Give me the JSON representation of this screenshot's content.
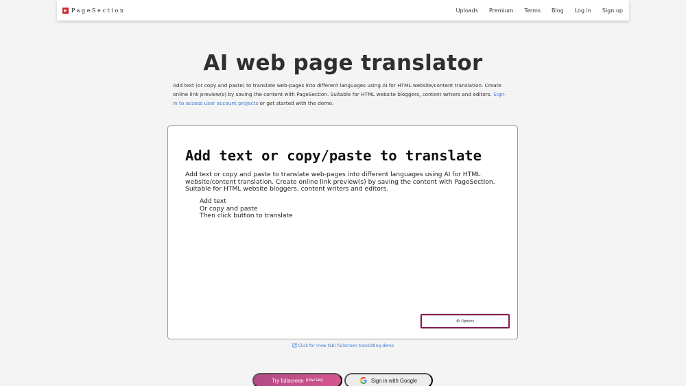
{
  "navbar": {
    "brand": "PageSection",
    "links": [
      "Uploads",
      "Premium",
      "Terms",
      "Blog",
      "Log in",
      "Sign up"
    ]
  },
  "hero": {
    "title": "AI web page translator",
    "intro_text": "Add text (or copy and paste) to translate web-pages into different languages using AI for HTML website/content translation. Create online link preview(s) by saving the content with PageSection. Suitable for HTML website bloggers, content writers and editors.",
    "signin_link": "Sign-in to access user account projects",
    "intro_tail": "or get started with the demo."
  },
  "demo": {
    "heading": "Add text or copy/paste to translate",
    "paragraph": "Add text or copy and paste to translate web-pages into different languages using AI for HTML website/content translation. Create online link preview(s) by saving the content with PageSection. Suitable for HTML website bloggers, content writers and editors.",
    "steps": [
      "Add text",
      "Or copy and paste",
      "Then click button to translate"
    ],
    "options_label": "Options"
  },
  "fullscreen_link": "Click for (new tab) fullscreen translating-demo",
  "actions": {
    "try_label": "Try fullscreen",
    "try_sub": "(new tab)",
    "google_label": "Sign in with Google"
  },
  "colors": {
    "link": "#3a7bd5",
    "brand_logo": "#d0262f",
    "options_border": "#8a1a52",
    "try_gradient_start": "#b24a87",
    "try_gradient_end": "#d6558e"
  }
}
